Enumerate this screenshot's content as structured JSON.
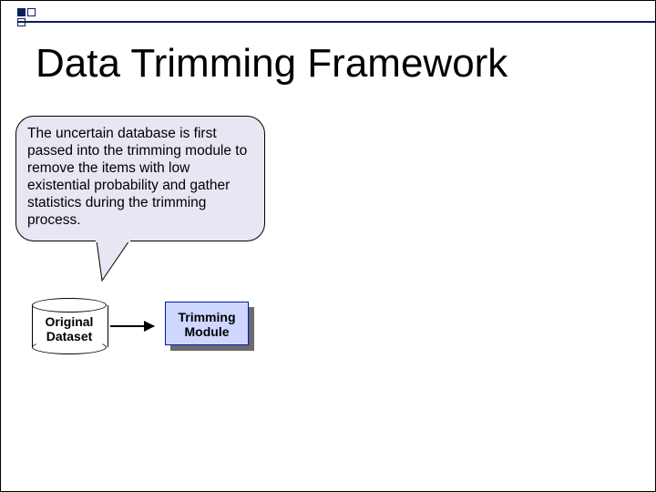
{
  "title": "Data Trimming Framework",
  "callout": {
    "text": "The uncertain database is first passed into the trimming module to remove the items with low existential probability and gather statistics during the trimming process."
  },
  "cylinder": {
    "line1": "Original",
    "line2": "Dataset"
  },
  "module": {
    "line1": "Trimming",
    "line2": "Module"
  }
}
